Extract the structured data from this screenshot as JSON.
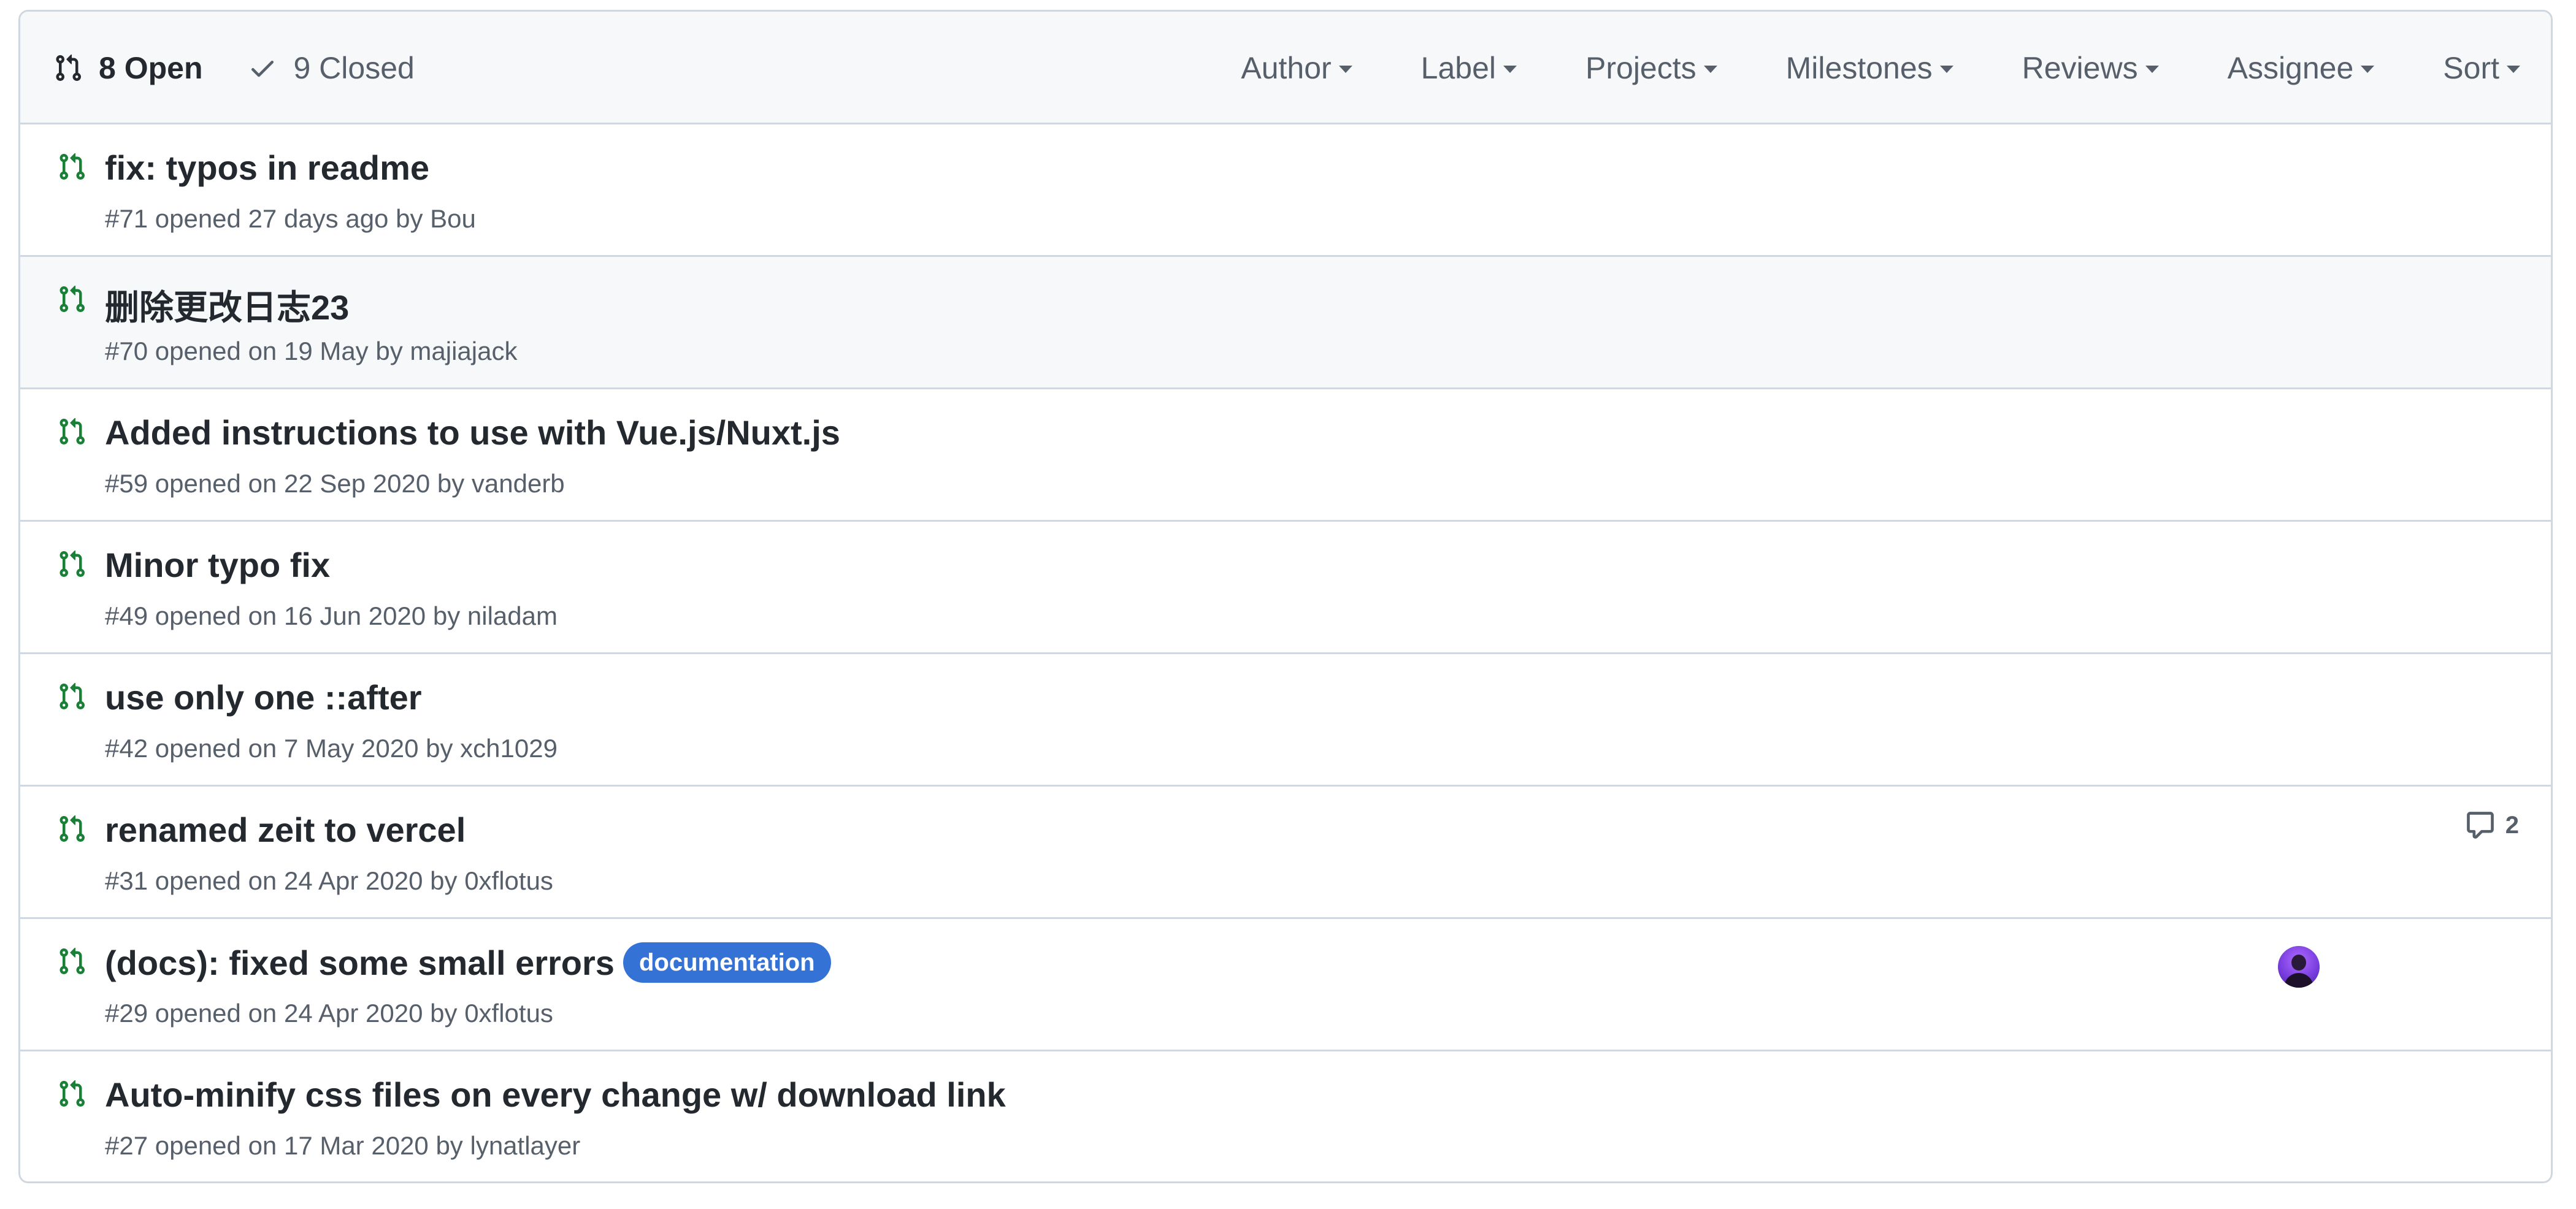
{
  "header": {
    "open_label": "8 Open",
    "closed_label": "9 Closed",
    "filters": [
      "Author",
      "Label",
      "Projects",
      "Milestones",
      "Reviews",
      "Assignee",
      "Sort"
    ]
  },
  "pull_requests": [
    {
      "title": "fix: typos in readme",
      "number": "#71",
      "opened": "opened 27 days ago",
      "by": "by",
      "author": "Bou"
    },
    {
      "title": "删除更改日志23",
      "number": "#70",
      "opened": "opened on 19 May",
      "by": "by",
      "author": "majiajack"
    },
    {
      "title": "Added instructions to use with Vue.js/Nuxt.js",
      "number": "#59",
      "opened": "opened on 22 Sep 2020",
      "by": "by",
      "author": "vanderb"
    },
    {
      "title": "Minor typo fix",
      "number": "#49",
      "opened": "opened on 16 Jun 2020",
      "by": "by",
      "author": "niladam"
    },
    {
      "title": "use only one ::after",
      "number": "#42",
      "opened": "opened on 7 May 2020",
      "by": "by",
      "author": "xch1029"
    },
    {
      "title": "renamed zeit to vercel",
      "number": "#31",
      "opened": "opened on 24 Apr 2020",
      "by": "by",
      "author": "0xflotus",
      "comments": "2"
    },
    {
      "title": "(docs): fixed some small errors",
      "number": "#29",
      "opened": "opened on 24 Apr 2020",
      "by": "by",
      "author": "0xflotus",
      "label": "documentation"
    },
    {
      "title": "Auto-minify css files on every change w/ download link",
      "number": "#27",
      "opened": "opened on 17 Mar 2020",
      "by": "by",
      "author": "lynatlayer"
    }
  ],
  "colors": {
    "open_icon": "#1a7f37",
    "label_documentation": "#3572d6",
    "header_bg": "#f6f8fa",
    "border": "#d0d7de"
  },
  "icons": {
    "state_open": "git-pull-request-icon",
    "state_closed": "check-icon",
    "comments": "comment-icon"
  }
}
